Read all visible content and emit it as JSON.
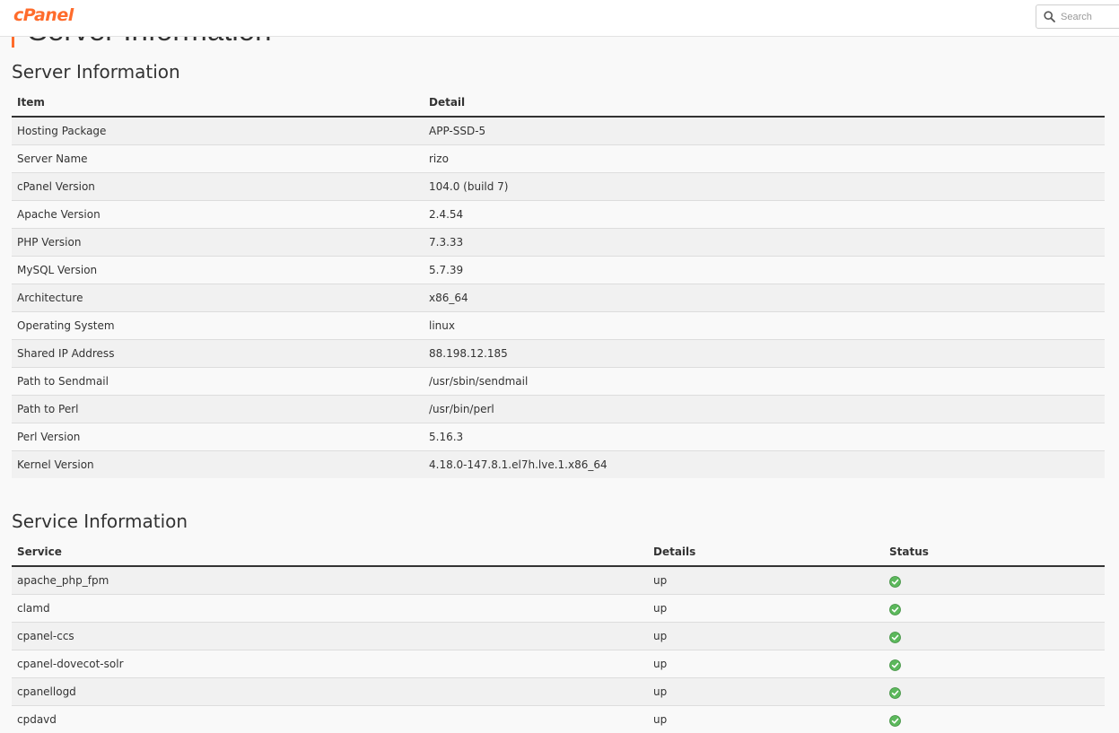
{
  "header": {
    "logo": "cPanel",
    "search_placeholder": "Search"
  },
  "page_title": "Server Information",
  "server_section": {
    "title": "Server Information",
    "columns": [
      "Item",
      "Detail"
    ],
    "rows": [
      {
        "item": "Hosting Package",
        "detail": "APP-SSD-5"
      },
      {
        "item": "Server Name",
        "detail": "rizo"
      },
      {
        "item": "cPanel Version",
        "detail": "104.0 (build 7)"
      },
      {
        "item": "Apache Version",
        "detail": "2.4.54"
      },
      {
        "item": "PHP Version",
        "detail": "7.3.33"
      },
      {
        "item": "MySQL Version",
        "detail": "5.7.39"
      },
      {
        "item": "Architecture",
        "detail": "x86_64"
      },
      {
        "item": "Operating System",
        "detail": "linux"
      },
      {
        "item": "Shared IP Address",
        "detail": "88.198.12.185"
      },
      {
        "item": "Path to Sendmail",
        "detail": "/usr/sbin/sendmail"
      },
      {
        "item": "Path to Perl",
        "detail": "/usr/bin/perl"
      },
      {
        "item": "Perl Version",
        "detail": "5.16.3"
      },
      {
        "item": "Kernel Version",
        "detail": "4.18.0-147.8.1.el7h.lve.1.x86_64"
      }
    ]
  },
  "service_section": {
    "title": "Service Information",
    "columns": [
      "Service",
      "Details",
      "Status"
    ],
    "rows": [
      {
        "service": "apache_php_fpm",
        "details": "up",
        "status": "ok-icon"
      },
      {
        "service": "clamd",
        "details": "up",
        "status": "ok-icon"
      },
      {
        "service": "cpanel-ccs",
        "details": "up",
        "status": "ok-icon"
      },
      {
        "service": "cpanel-dovecot-solr",
        "details": "up",
        "status": "ok-icon"
      },
      {
        "service": "cpanellogd",
        "details": "up",
        "status": "ok-icon"
      },
      {
        "service": "cpdavd",
        "details": "up",
        "status": "ok-icon"
      }
    ]
  },
  "colors": {
    "brand": "#ff6c2c",
    "status_ok": "#5cb85c"
  }
}
